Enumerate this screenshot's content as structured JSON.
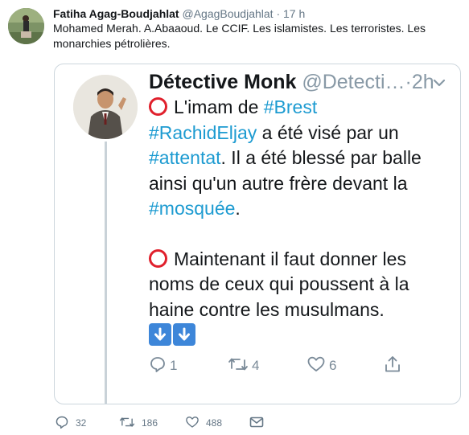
{
  "outer_tweet": {
    "display_name": "Fatiha Agag-Boudjahlat",
    "handle": "@AgagBoudjahlat",
    "separator": "·",
    "time": "17 h",
    "text": "Mohamed Merah. A.Abaaoud. Le CCIF. Les islamistes. Les terroristes. Les monarchies pétrolières.",
    "actions": {
      "reply_count": "32",
      "retweet_count": "186",
      "like_count": "488"
    }
  },
  "quoted_tweet": {
    "display_name": "Détective Monk",
    "handle": "@Detecti…",
    "separator": "·",
    "time": "2h",
    "line1_text": "L'imam de ",
    "line1_tag": "#Brest",
    "line2_tag": "#RachidEljay",
    "line2_text": " a été visé par un",
    "line3_tag": "#attentat",
    "line3_text": ". Il a été blessé par balle",
    "line4_text": "ainsi qu'un autre frère devant la",
    "line5_tag": "#mosquée",
    "line5_text": ".",
    "para2_line1": "Maintenant il faut donner les",
    "para2_line2": "noms de ceux qui poussent à la",
    "para2_line3": "haine contre les musulmans.",
    "emoji_names": [
      "red-circle-icon",
      "down-arrow-icon"
    ],
    "actions": {
      "reply_count": "1",
      "retweet_count": "4",
      "like_count": "6"
    }
  },
  "colors": {
    "hashtag": "#1d9bd1",
    "red_circle": "#e0202c",
    "arrow_button": "#3d86d9",
    "muted_text": "#657786"
  }
}
